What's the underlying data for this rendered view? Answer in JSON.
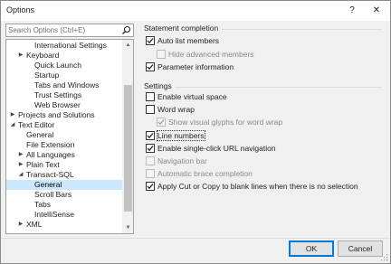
{
  "window": {
    "title": "Options",
    "help_glyph": "?",
    "close_glyph": "✕"
  },
  "search": {
    "placeholder": "Search Options (Ctrl+E)",
    "value": "",
    "icon": "search-icon"
  },
  "tree": {
    "items": [
      {
        "label": "International Settings",
        "indent": 2,
        "arrow": ""
      },
      {
        "label": "Keyboard",
        "indent": 1,
        "arrow": "▶"
      },
      {
        "label": "Quick Launch",
        "indent": 2,
        "arrow": ""
      },
      {
        "label": "Startup",
        "indent": 2,
        "arrow": ""
      },
      {
        "label": "Tabs and Windows",
        "indent": 2,
        "arrow": ""
      },
      {
        "label": "Trust Settings",
        "indent": 2,
        "arrow": ""
      },
      {
        "label": "Web Browser",
        "indent": 2,
        "arrow": ""
      },
      {
        "label": "Projects and Solutions",
        "indent": 0,
        "arrow": "▶"
      },
      {
        "label": "Text Editor",
        "indent": 0,
        "arrow": "◢"
      },
      {
        "label": "General",
        "indent": 1,
        "arrow": ""
      },
      {
        "label": "File Extension",
        "indent": 1,
        "arrow": ""
      },
      {
        "label": "All Languages",
        "indent": 1,
        "arrow": "▶"
      },
      {
        "label": "Plain Text",
        "indent": 1,
        "arrow": "▶"
      },
      {
        "label": "Transact-SQL",
        "indent": 1,
        "arrow": "◢"
      },
      {
        "label": "General",
        "indent": 2,
        "arrow": "",
        "selected": true
      },
      {
        "label": "Scroll Bars",
        "indent": 2,
        "arrow": ""
      },
      {
        "label": "Tabs",
        "indent": 2,
        "arrow": ""
      },
      {
        "label": "IntelliSense",
        "indent": 2,
        "arrow": ""
      },
      {
        "label": "XML",
        "indent": 1,
        "arrow": "▶"
      }
    ],
    "scroll_up": "▲",
    "scroll_down": "▼"
  },
  "statement_completion": {
    "label": "Statement completion",
    "options": [
      {
        "label": "Auto list members",
        "checked": true,
        "disabled": false,
        "indent": 0
      },
      {
        "label": "Hide advanced members",
        "checked": false,
        "disabled": true,
        "indent": 1
      },
      {
        "label": "Parameter information",
        "checked": true,
        "disabled": false,
        "indent": 0
      }
    ]
  },
  "settings": {
    "label": "Settings",
    "options": [
      {
        "label": "Enable virtual space",
        "checked": false,
        "disabled": false,
        "indent": 0
      },
      {
        "label": "Word wrap",
        "checked": false,
        "disabled": false,
        "indent": 0
      },
      {
        "label": "Show visual glyphs for word wrap",
        "checked": true,
        "disabled": true,
        "indent": 1
      },
      {
        "label": "Line numbers",
        "checked": true,
        "disabled": false,
        "indent": 0,
        "focused": true
      },
      {
        "label": "Enable single-click URL navigation",
        "checked": true,
        "disabled": false,
        "indent": 0
      },
      {
        "label": "Navigation bar",
        "checked": false,
        "disabled": true,
        "indent": 0
      },
      {
        "label": "Automatic brace completion",
        "checked": false,
        "disabled": true,
        "indent": 0
      },
      {
        "label": "Apply Cut or Copy to blank lines when there is no selection",
        "checked": true,
        "disabled": false,
        "indent": 0
      }
    ]
  },
  "buttons": {
    "ok": "OK",
    "cancel": "Cancel"
  },
  "colors": {
    "selection": "#cce8ff",
    "default_button_border": "#0078d7"
  }
}
